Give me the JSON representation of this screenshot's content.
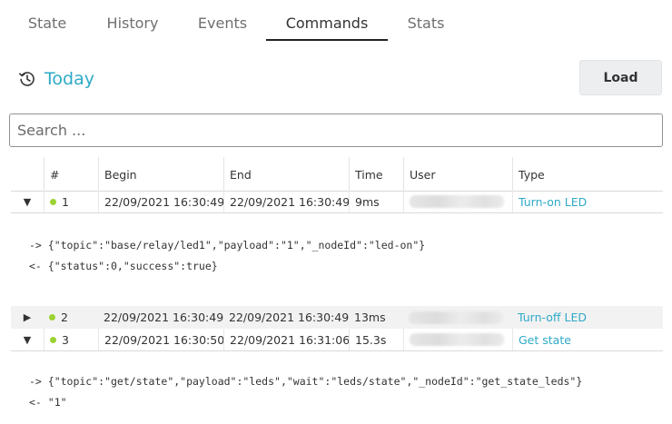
{
  "tabs": [
    "State",
    "History",
    "Events",
    "Commands",
    "Stats"
  ],
  "active_tab": "Commands",
  "date_label": "Today",
  "load_label": "Load",
  "search": {
    "placeholder": "Search ...",
    "value": ""
  },
  "table": {
    "headers": [
      "#",
      "Begin",
      "End",
      "Time",
      "User",
      "Type"
    ],
    "rows": [
      {
        "toggle": "▼",
        "num": "1",
        "begin": "22/09/2021 16:30:49",
        "end": "22/09/2021 16:30:49",
        "time": "9ms",
        "type": "Turn-on LED",
        "request": "-> {\"topic\":\"base/relay/led1\",\"payload\":\"1\",\"_nodeId\":\"led-on\"}",
        "response": "<- {\"status\":0,\"success\":true}"
      },
      {
        "toggle": "▶",
        "num": "2",
        "begin": "22/09/2021 16:30:49",
        "end": "22/09/2021 16:30:49",
        "time": "13ms",
        "type": "Turn-off LED"
      },
      {
        "toggle": "▼",
        "num": "3",
        "begin": "22/09/2021 16:30:50",
        "end": "22/09/2021 16:31:06",
        "time": "15.3s",
        "type": "Get state",
        "request": "-> {\"topic\":\"get/state\",\"payload\":\"leds\",\"wait\":\"leds/state\",\"_nodeId\":\"get_state_leds\"}",
        "response": "<- \"1\""
      }
    ]
  },
  "colors": {
    "accent": "#2eaac7",
    "status_ok": "#9bd233"
  },
  "icons": {
    "history": "history-icon"
  }
}
